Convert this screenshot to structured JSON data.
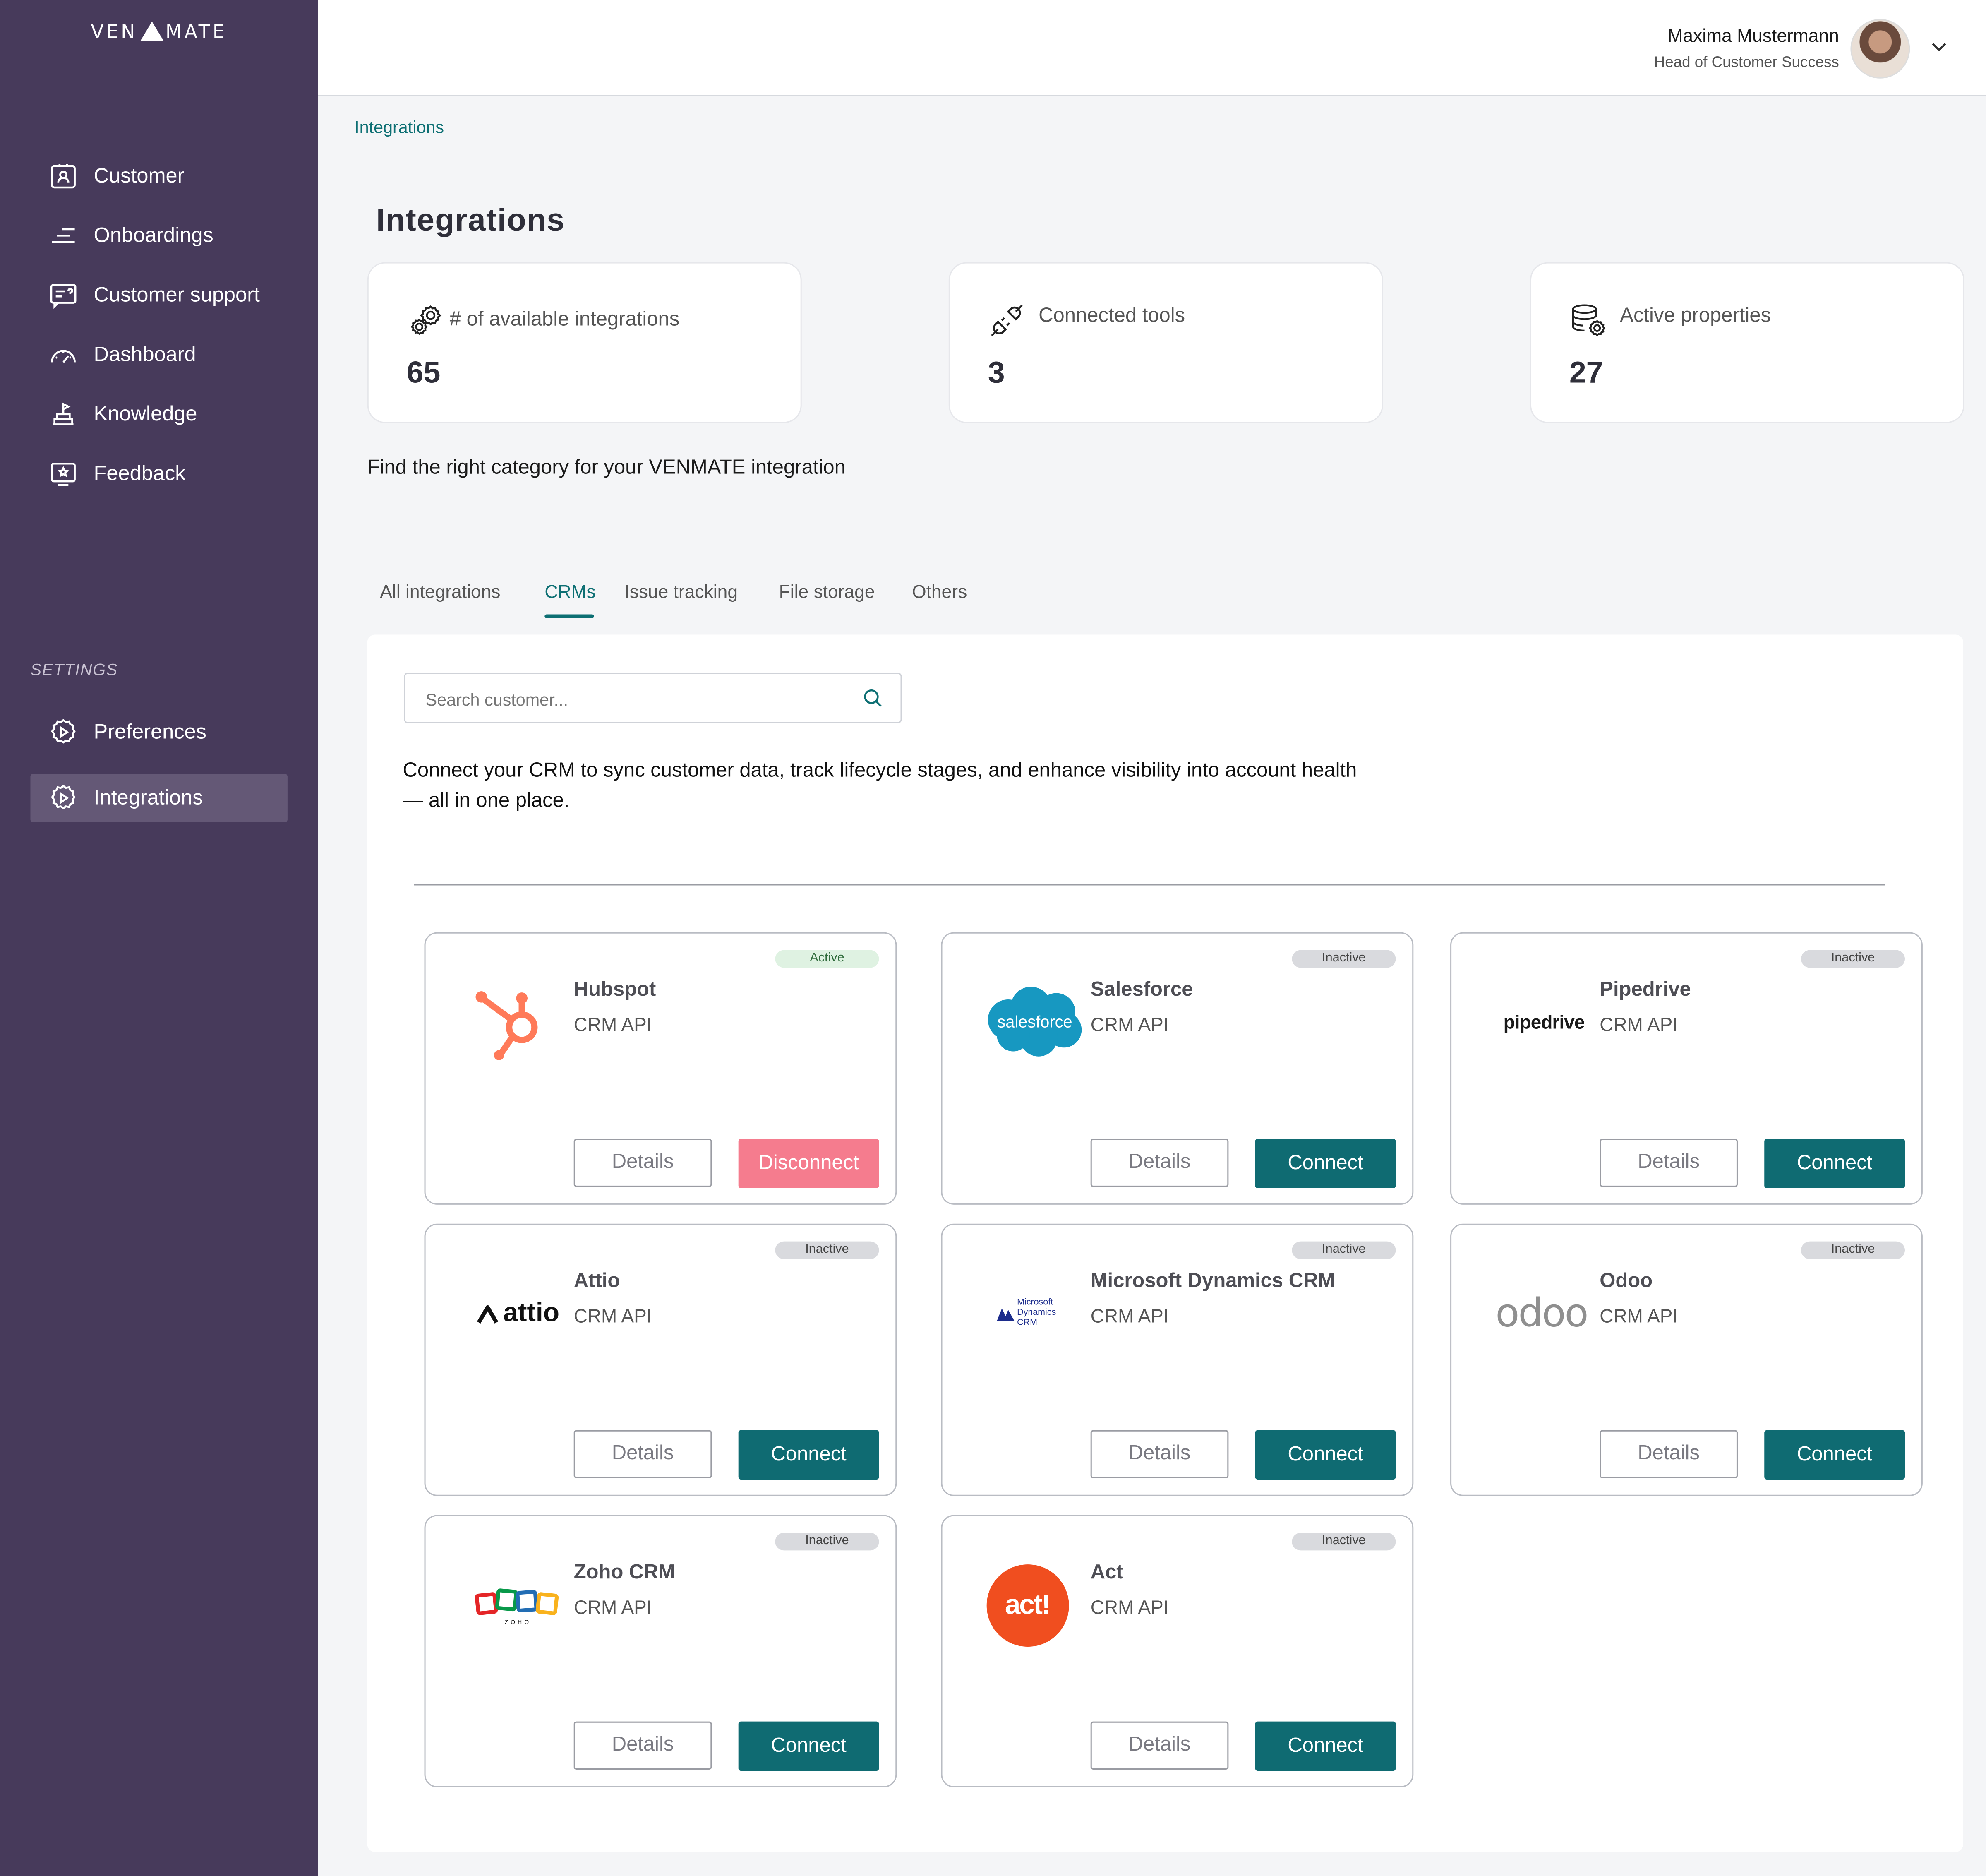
{
  "app": {
    "logo_left": "VEN",
    "logo_right": "MATE"
  },
  "sidebar": {
    "items": [
      {
        "label": "Customer",
        "icon": "customer-icon"
      },
      {
        "label": "Onboardings",
        "icon": "onboardings-icon"
      },
      {
        "label": "Customer support",
        "icon": "support-icon"
      },
      {
        "label": "Dashboard",
        "icon": "dashboard-icon"
      },
      {
        "label": "Knowledge",
        "icon": "knowledge-icon"
      },
      {
        "label": "Feedback",
        "icon": "feedback-icon"
      }
    ],
    "settings_label": "SETTINGS",
    "settings_items": [
      {
        "label": "Preferences",
        "icon": "gear-icon"
      },
      {
        "label": "Integrations",
        "icon": "gear-icon",
        "active": true
      }
    ]
  },
  "header": {
    "user_name": "Maxima Mustermann",
    "user_role": "Head of Customer Success"
  },
  "breadcrumb": "Integrations",
  "page_title": "Integrations",
  "stats": [
    {
      "label": "# of available integrations",
      "value": "65",
      "icon": "gears-icon"
    },
    {
      "label": "Connected tools",
      "value": "3",
      "icon": "plug-icon"
    },
    {
      "label": "Active properties",
      "value": "27",
      "icon": "database-gear-icon"
    }
  ],
  "find_text": "Find the right category for your VENMATE integration",
  "tabs": [
    {
      "label": "All integrations"
    },
    {
      "label": "CRMs",
      "active": true
    },
    {
      "label": "Issue tracking"
    },
    {
      "label": "File storage"
    },
    {
      "label": "Others"
    }
  ],
  "search": {
    "placeholder": "Search customer..."
  },
  "description": "Connect your CRM to sync customer data, track lifecycle stages, and enhance visibility into account health — all in one place.",
  "cards": [
    {
      "name": "Hubspot",
      "sub": "CRM API",
      "status": "Active",
      "details": "Details",
      "action": "Disconnect"
    },
    {
      "name": "Salesforce",
      "sub": "CRM API",
      "status": "Inactive",
      "details": "Details",
      "action": "Connect",
      "logo_text": "salesforce"
    },
    {
      "name": "Pipedrive",
      "sub": "CRM API",
      "status": "Inactive",
      "details": "Details",
      "action": "Connect",
      "logo_text": "pipedrive"
    },
    {
      "name": "Attio",
      "sub": "CRM API",
      "status": "Inactive",
      "details": "Details",
      "action": "Connect",
      "logo_text": "attio"
    },
    {
      "name": "Microsoft Dynamics CRM",
      "sub": "CRM API",
      "status": "Inactive",
      "details": "Details",
      "action": "Connect",
      "logo_text": "Microsoft Dynamics CRM"
    },
    {
      "name": "Odoo",
      "sub": "CRM API",
      "status": "Inactive",
      "details": "Details",
      "action": "Connect",
      "logo_text": "odoo"
    },
    {
      "name": "Zoho CRM",
      "sub": "CRM API",
      "status": "Inactive",
      "details": "Details",
      "action": "Connect",
      "logo_text": "ZOHO"
    },
    {
      "name": "Act",
      "sub": "CRM API",
      "status": "Inactive",
      "details": "Details",
      "action": "Connect",
      "logo_text": "act!"
    }
  ],
  "colors": {
    "sidebar": "#473a5b",
    "accent": "#0f6b72",
    "danger": "#f57c8e",
    "active_badge": "#dff2e2",
    "inactive_badge": "#d9dade"
  }
}
